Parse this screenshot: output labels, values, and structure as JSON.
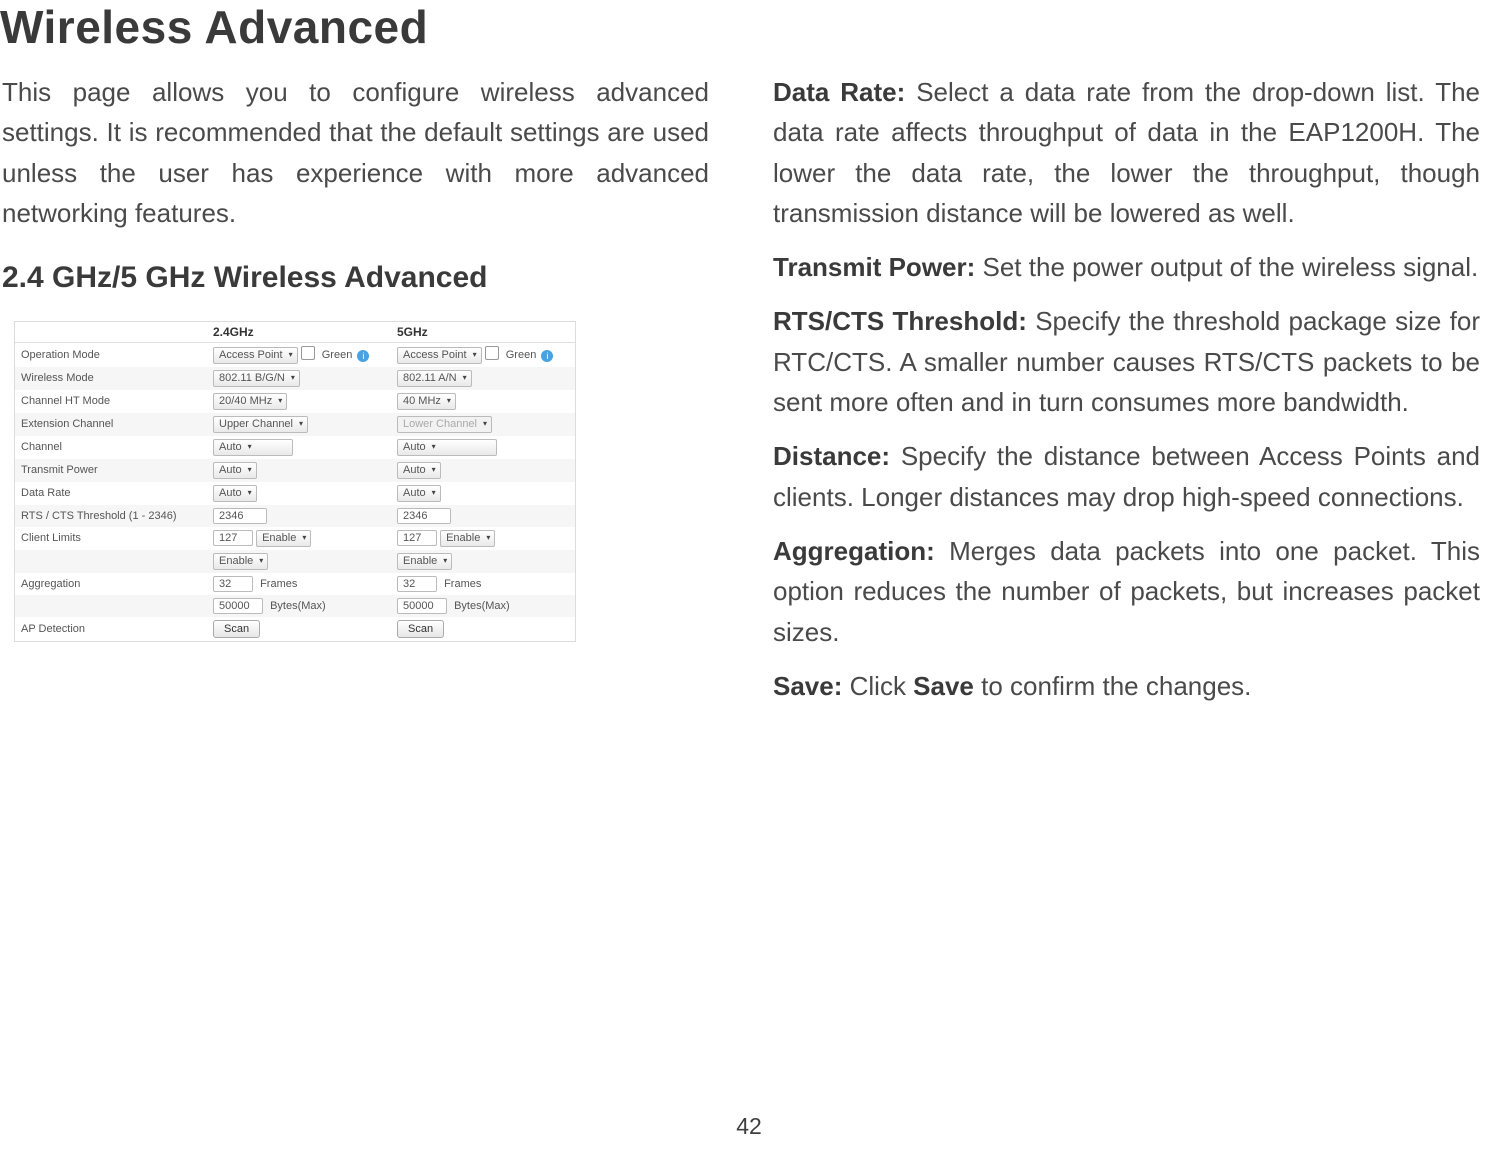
{
  "title": "Wireless Advanced",
  "intro": "This page allows you to configure wireless advanced settings. It is recommended that the default settings are used unless the user has experience with more advanced networking features.",
  "subhead": "2.4 GHz/5 GHz Wireless Advanced",
  "pagenum": "42",
  "defs": [
    {
      "term": "Data Rate:",
      "text": " Select a data rate from the drop-down list. The data rate affects throughput of data in the EAP1200H. The lower the data rate, the lower the throughput, though transmission distance will be lowered as well."
    },
    {
      "term": "Transmit Power:",
      "text": " Set the power output of the wireless signal."
    },
    {
      "term": "RTS/CTS Threshold:",
      "text": " Specify the threshold package size for RTC/CTS. A smaller number causes RTS/CTS packets to be sent more often and in turn consumes more bandwidth."
    },
    {
      "term": "Distance:",
      "text": " Specify the distance between Access Points and clients. Longer distances may drop high-speed connections."
    },
    {
      "term": "Aggregation:",
      "text": " Merges data packets into one packet. This option reduces the number of packets, but increases packet sizes."
    },
    {
      "term": "Save:",
      "text_pre": " Click ",
      "bold": "Save",
      "text_post": " to confirm the changes."
    }
  ],
  "shot": {
    "headers": {
      "col_24": "2.4GHz",
      "col_5": "5GHz"
    },
    "green_label": "Green",
    "rows": {
      "operation_mode": {
        "label": "Operation Mode",
        "v24": "Access Point",
        "v5": "Access Point"
      },
      "wireless_mode": {
        "label": "Wireless Mode",
        "v24": "802.11 B/G/N",
        "v5": "802.11 A/N"
      },
      "channel_ht_mode": {
        "label": "Channel HT Mode",
        "v24": "20/40 MHz",
        "v5": "40 MHz"
      },
      "extension_channel": {
        "label": "Extension Channel",
        "v24": "Upper Channel",
        "v5": "Lower Channel"
      },
      "channel": {
        "label": "Channel",
        "v24": "Auto",
        "v5": "Auto"
      },
      "transmit_power": {
        "label": "Transmit Power",
        "v24": "Auto",
        "v5": "Auto"
      },
      "data_rate": {
        "label": "Data Rate",
        "v24": "Auto",
        "v5": "Auto"
      },
      "rts": {
        "label": "RTS / CTS Threshold (1 - 2346)",
        "v24": "2346",
        "v5": "2346"
      },
      "client_limits": {
        "label": "Client Limits",
        "v24": "127",
        "v5": "127",
        "opt": "Enable"
      },
      "aggregation": {
        "label": "Aggregation",
        "opt": "Enable",
        "frames": "32",
        "frames_unit": "Frames",
        "bytes": "50000",
        "bytes_unit": "Bytes(Max)"
      },
      "ap_detection": {
        "label": "AP Detection",
        "btn": "Scan"
      }
    }
  }
}
